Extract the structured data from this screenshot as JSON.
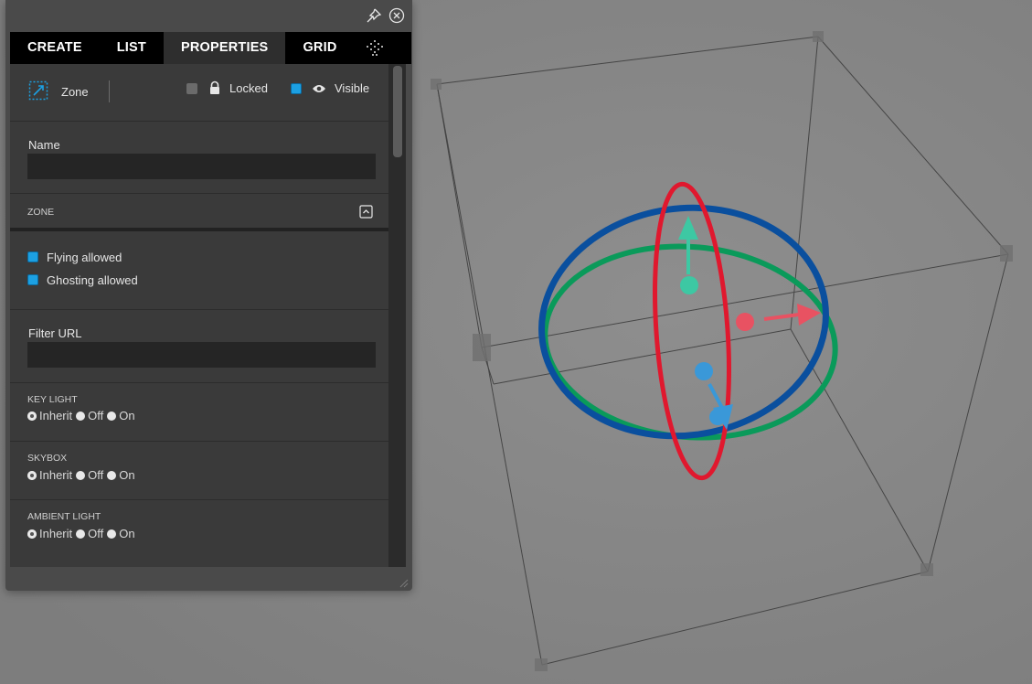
{
  "tabs": [
    {
      "label": "CREATE"
    },
    {
      "label": "LIST"
    },
    {
      "label": "PROPERTIES"
    },
    {
      "label": "GRID"
    }
  ],
  "header": {
    "entity_type": "Zone",
    "locked_label": "Locked",
    "visible_label": "Visible",
    "locked_checked": false,
    "visible_checked": true
  },
  "name_section": {
    "label": "Name",
    "value": ""
  },
  "zone_section": {
    "title": "ZONE"
  },
  "flags": {
    "flying_label": "Flying allowed",
    "ghosting_label": "Ghosting allowed",
    "flying_checked": true,
    "ghosting_checked": true
  },
  "filter_section": {
    "label": "Filter URL",
    "value": ""
  },
  "radio_groups": [
    {
      "title": "KEY LIGHT",
      "options": [
        "Inherit",
        "Off",
        "On"
      ],
      "selected": "Inherit"
    },
    {
      "title": "SKYBOX",
      "options": [
        "Inherit",
        "Off",
        "On"
      ],
      "selected": "Inherit"
    },
    {
      "title": "AMBIENT LIGHT",
      "options": [
        "Inherit",
        "Off",
        "On"
      ],
      "selected": "Inherit"
    }
  ],
  "colors": {
    "accent": "#1ca0e2",
    "x_axis": "#e0182e",
    "y_axis": "#0a4f9e",
    "z_axis": "#0a9a5a"
  },
  "icons": [
    "pin-icon",
    "close-icon",
    "dots-icon",
    "zone-icon",
    "lock-icon",
    "eye-icon",
    "collapse-icon"
  ]
}
